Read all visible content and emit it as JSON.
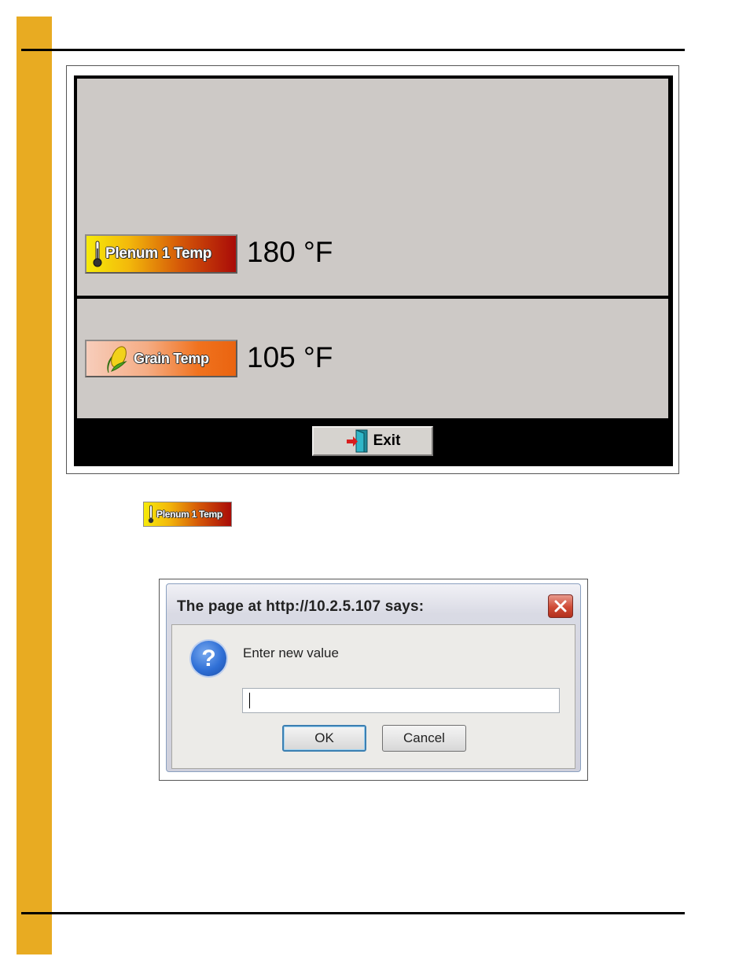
{
  "colors": {
    "side_bar": "#e8ab22",
    "panel_background": "#cdc9c6",
    "plenum_button_gradient": [
      "#f6ea0a",
      "#a90b08"
    ],
    "grain_button_gradient": [
      "#f7cdbb",
      "#ea6410"
    ]
  },
  "controller": {
    "plenum": {
      "label": "Plenum 1 Temp",
      "value": "180 °F",
      "icon": "thermometer-icon"
    },
    "grain": {
      "label": "Grain Temp",
      "value": "105 °F",
      "icon": "corn-icon"
    },
    "exit": {
      "label": "Exit",
      "icon": "exit-door-icon"
    }
  },
  "inline_button": {
    "label": "Plenum 1 Temp",
    "icon": "thermometer-icon"
  },
  "dialog": {
    "title": "The page at http://10.2.5.107 says:",
    "message": "Enter new value",
    "input_value": "",
    "ok_label": "OK",
    "cancel_label": "Cancel",
    "icon": "question-icon",
    "close_icon": "close-icon"
  }
}
